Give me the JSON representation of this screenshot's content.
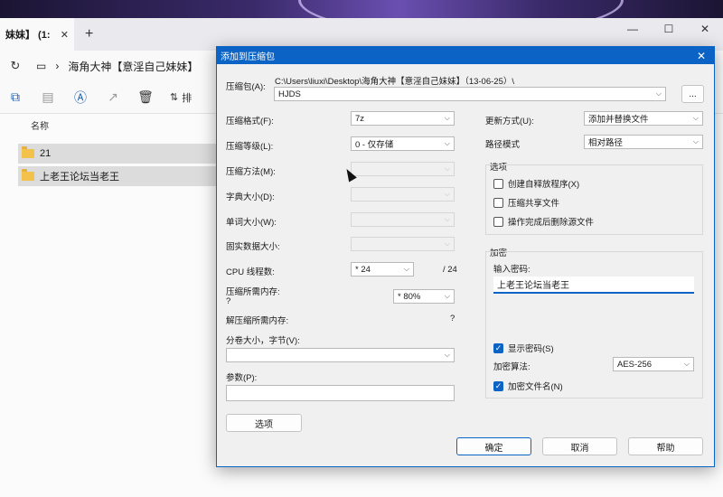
{
  "explorer": {
    "tab_title": "妹妹】 (1:",
    "tab_close": "✕",
    "new_tab": "+",
    "window_controls": [
      "—",
      "☐",
      "✕"
    ],
    "path_sep": "›",
    "path": "海角大神【意淫自己妹妹】",
    "sort_label": "排",
    "column_name": "名称",
    "files": [
      {
        "name": "21"
      },
      {
        "name": "上老王论坛当老王"
      }
    ]
  },
  "dialog": {
    "title": "添加到压缩包",
    "close": "✕",
    "archive_label": "压缩包(A):",
    "archive_path": "C:\\Users\\liuxi\\Desktop\\海角大神【意淫自己妹妹】（13-06-25）\\",
    "archive_name": "HJDS",
    "browse_label": "...",
    "format_label": "压缩格式(F):",
    "format_value": "7z",
    "level_label": "压缩等级(L):",
    "level_value": "0 - 仅存储",
    "method_label": "压缩方法(M):",
    "dict_label": "字典大小(D):",
    "word_label": "单词大小(W):",
    "solid_label": "固实数据大小:",
    "cpu_label": "CPU 线程数:",
    "cpu_value": "* 24",
    "cpu_total": "/ 24",
    "mem_label": "压缩所需内存:",
    "mem_q": "?",
    "mem_value": "* 80%",
    "decomp_label": "解压缩所需内存:",
    "decomp_q": "?",
    "split_label": "分卷大小，字节(V):",
    "split_value": "",
    "params_label": "参数(P):",
    "params_value": "",
    "options_button": "选项",
    "update_label": "更新方式(U):",
    "update_value": "添加并替换文件",
    "pathmode_label": "路径模式",
    "pathmode_value": "相对路径",
    "options_group": "选项",
    "opt_sfx": "创建自释放程序(X)",
    "opt_shared": "压缩共享文件",
    "opt_delete": "操作完成后删除源文件",
    "encrypt_group": "加密",
    "password_label": "输入密码:",
    "password_value": "上老王论坛当老王",
    "show_password": "显示密码(S)",
    "enc_method_label": "加密算法:",
    "enc_method_value": "AES-256",
    "enc_names": "加密文件名(N)",
    "ok": "确定",
    "cancel": "取消",
    "help": "帮助",
    "checkmark": "✓",
    "dropdown_arrow": "⌵"
  }
}
